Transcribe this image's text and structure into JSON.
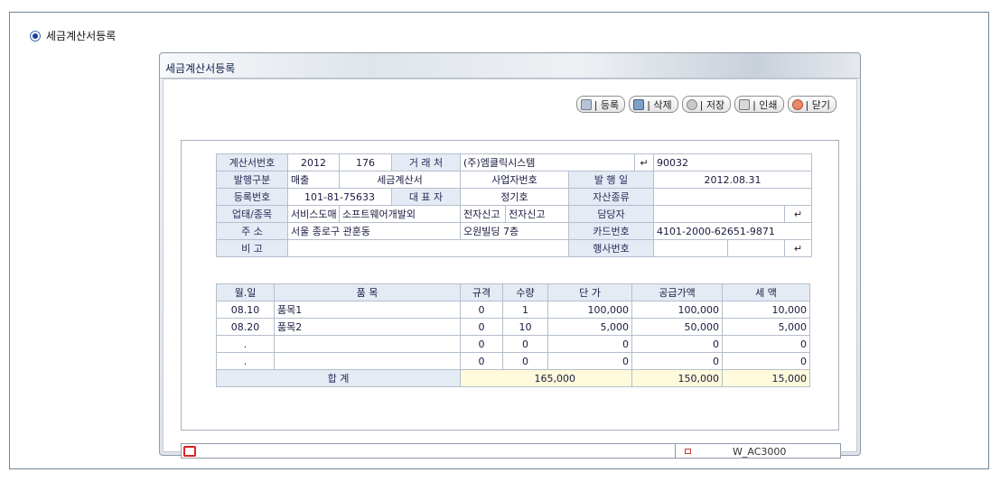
{
  "page_title": "세금계산서등록",
  "window_title": "세금계산서등록",
  "toolbar": {
    "register": "| 등록",
    "delete": "| 삭제",
    "save": "| 저장",
    "print": "| 인쇄",
    "close": "| 닫기"
  },
  "header": {
    "invoice_no_label": "계산서번호",
    "invoice_year": "2012",
    "invoice_seq": "176",
    "client_label": "거 래 처",
    "client_name": "(주)엠클릭시스템",
    "client_code": "90032",
    "issue_type_label": "발행구분",
    "issue_type": "매출",
    "doc_type": "세금계산서",
    "biz_no_heading": "사업자번호",
    "issue_date_label": "발 행 일",
    "issue_date": "2012.08.31",
    "reg_no_label": "등록번호",
    "reg_no": "101-81-75633",
    "ceo_label": "대 표 자",
    "ceo_name": "정기호",
    "asset_type_label": "자산종류",
    "asset_type": "",
    "business_label": "업태/종목",
    "business_type": "서비스도매",
    "business_item": "소프트웨어개발외",
    "e_report_1": "전자신고",
    "e_report_2": "전자신고",
    "manager_label": "담당자",
    "manager": "",
    "address_label": "주    소",
    "address_1": "서울 종로구 관훈동",
    "address_2": "오원빌딩 7층",
    "card_no_label": "카드번호",
    "card_no": "4101-2000-62651-9871",
    "remarks_label": "비    고",
    "remarks": "",
    "event_no_label": "행사번호",
    "event_no": ""
  },
  "items": {
    "columns": [
      "월.일",
      "품    목",
      "규격",
      "수량",
      "단 가",
      "공급가액",
      "세 액"
    ],
    "rows": [
      {
        "date": "08.10",
        "item": "품목1",
        "spec": "0",
        "qty": "1",
        "unit_price": "100,000",
        "supply": "100,000",
        "tax": "10,000"
      },
      {
        "date": "08.20",
        "item": "품목2",
        "spec": "0",
        "qty": "10",
        "unit_price": "5,000",
        "supply": "50,000",
        "tax": "5,000"
      },
      {
        "date": ".",
        "item": "",
        "spec": "0",
        "qty": "0",
        "unit_price": "0",
        "supply": "0",
        "tax": "0"
      },
      {
        "date": ".",
        "item": "",
        "spec": "0",
        "qty": "0",
        "unit_price": "0",
        "supply": "0",
        "tax": "0"
      }
    ],
    "total_label": "합       계",
    "total_amount": "165,000",
    "total_supply": "150,000",
    "total_tax": "15,000"
  },
  "status": {
    "screen_code": "W_AC3000"
  },
  "enter_glyph": "↵"
}
